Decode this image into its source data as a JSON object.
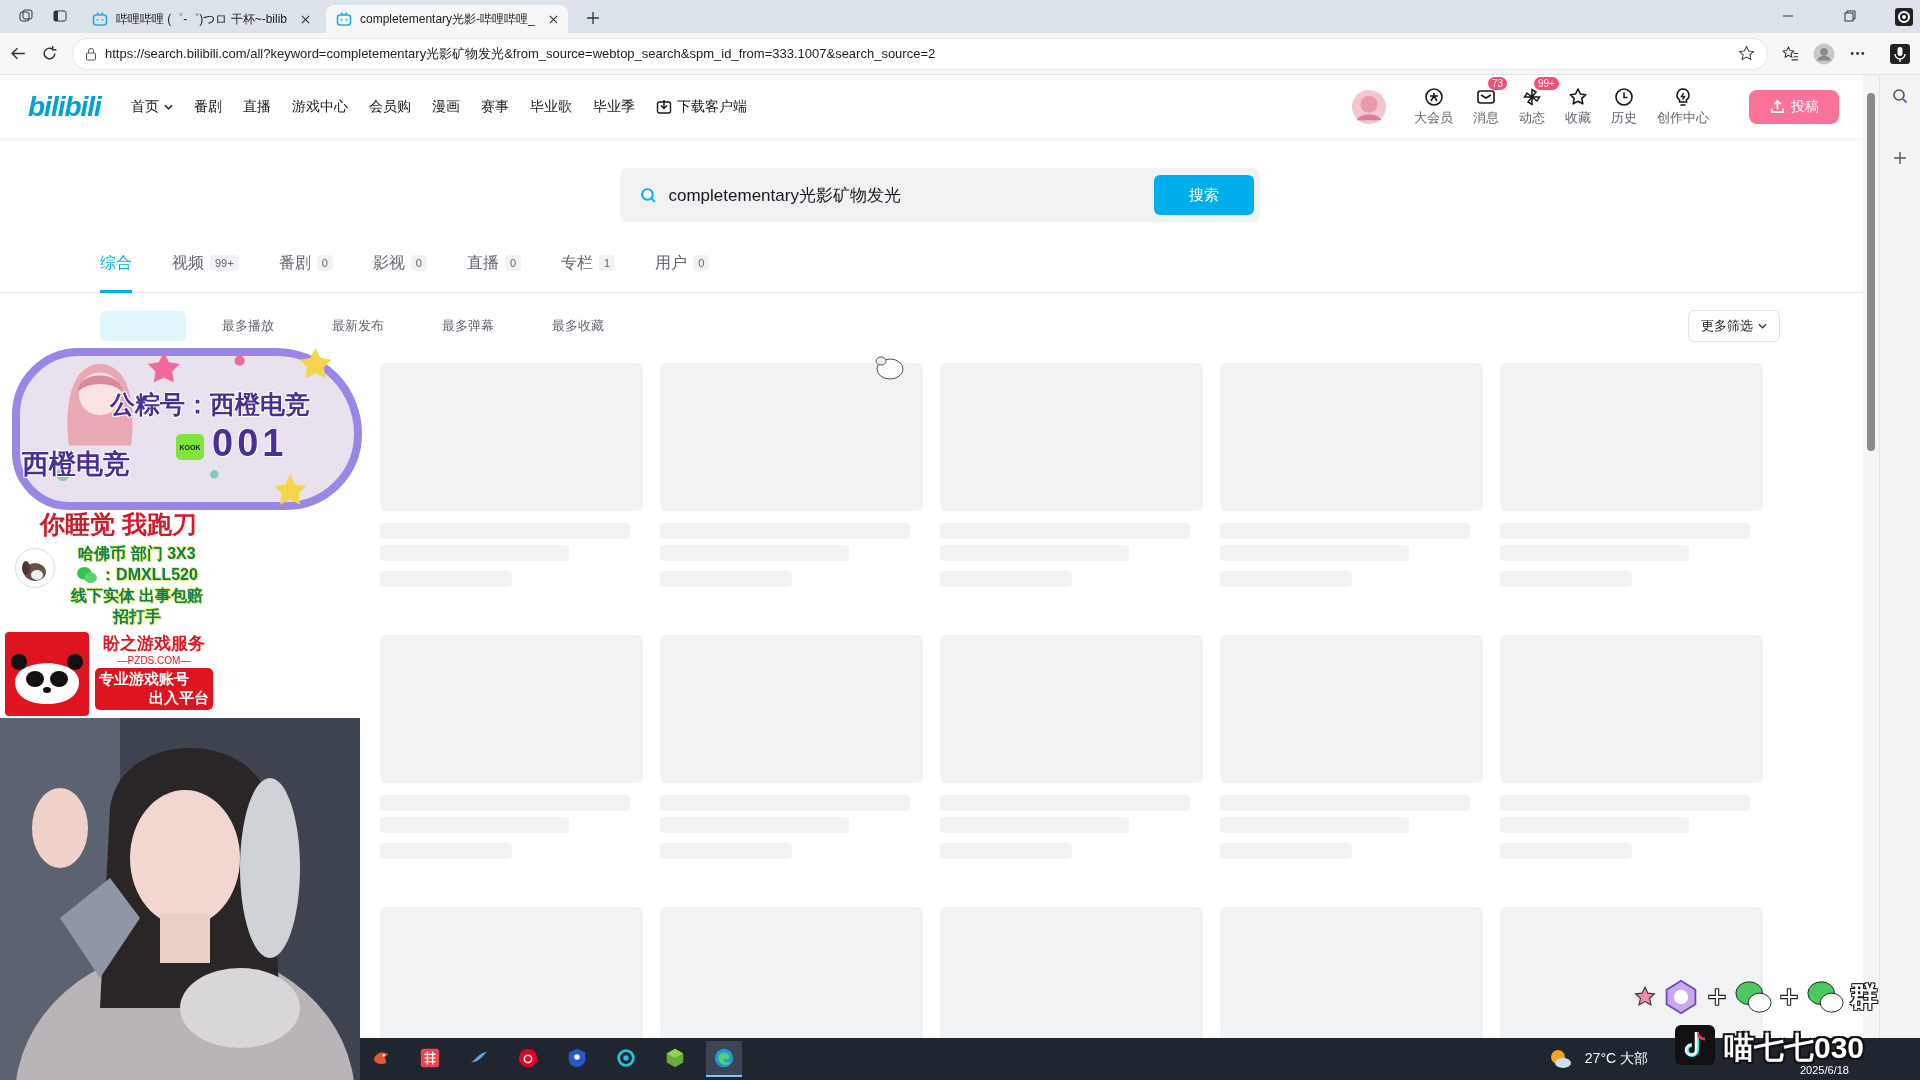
{
  "browser": {
    "tabs": [
      {
        "title": "哔哩哔哩 (゜-゜)つロ 干杯~-bilib",
        "selected": false
      },
      {
        "title": "completementary光影-哔哩哔哩_",
        "selected": true
      }
    ],
    "url": "https://search.bilibili.com/all?keyword=completementary光影矿物发光&from_source=webtop_search&spm_id_from=333.1007&search_source=2"
  },
  "header": {
    "logo": "bilibili",
    "nav": [
      {
        "label": "首页",
        "kind": "dropdown"
      },
      {
        "label": "番剧",
        "kind": "link"
      },
      {
        "label": "直播",
        "kind": "link"
      },
      {
        "label": "游戏中心",
        "kind": "link"
      },
      {
        "label": "会员购",
        "kind": "link"
      },
      {
        "label": "漫画",
        "kind": "link"
      },
      {
        "label": "赛事",
        "kind": "link"
      },
      {
        "label": "毕业歌",
        "kind": "link"
      },
      {
        "label": "毕业季",
        "kind": "link"
      },
      {
        "label": "下载客户端",
        "kind": "download"
      }
    ],
    "actions": [
      {
        "label": "大会员",
        "kind": "vip"
      },
      {
        "label": "消息",
        "kind": "mail",
        "badge": "73"
      },
      {
        "label": "动态",
        "kind": "fan",
        "badge": "99+"
      },
      {
        "label": "收藏",
        "kind": "star"
      },
      {
        "label": "历史",
        "kind": "clock"
      },
      {
        "label": "创作中心",
        "kind": "bulb"
      }
    ],
    "upload": "投稿"
  },
  "search": {
    "value": "completementary光影矿物发光",
    "button": "搜索"
  },
  "tabs": [
    {
      "label": "综合",
      "selected": true
    },
    {
      "label": "视频",
      "count": "99+",
      "selected": false
    },
    {
      "label": "番剧",
      "count": "0",
      "selected": false
    },
    {
      "label": "影视",
      "count": "0",
      "selected": false
    },
    {
      "label": "直播",
      "count": "0",
      "selected": false
    },
    {
      "label": "专栏",
      "count": "1",
      "selected": false
    },
    {
      "label": "用户",
      "count": "0",
      "selected": false
    }
  ],
  "filters": [
    {
      "selected": true
    },
    {
      "label": "最多播放",
      "selected": false
    },
    {
      "label": "最新发布",
      "selected": false
    },
    {
      "label": "最多弹幕",
      "selected": false
    },
    {
      "label": "最多收藏",
      "selected": false
    }
  ],
  "more_filters": "更多筛选",
  "results": [
    {
      "kind": "skeleton"
    },
    {
      "kind": "skeleton"
    },
    {
      "kind": "skeleton"
    },
    {
      "kind": "skeleton"
    },
    {
      "kind": "skeleton"
    },
    {
      "kind": "skeleton"
    },
    {
      "kind": "skeleton"
    },
    {
      "kind": "skeleton"
    },
    {
      "kind": "skeleton"
    },
    {
      "kind": "skeleton"
    },
    {
      "kind": "thumbnail"
    },
    {
      "kind": "thumbnail"
    },
    {
      "kind": "thumbnail"
    },
    {
      "kind": "thumbnail"
    },
    {
      "kind": "thumbnail"
    }
  ],
  "stream_overlay": {
    "banner_title": "公粽号：西橙电竞",
    "kook_logo": "KOOK",
    "kook_id": "001",
    "brand": "西橙电竞",
    "slogan": "你睡觉 我跑刀",
    "promo_lines": [
      "哈佛币 部门 3X3",
      "：DMXLL520",
      "线下实体 出事包赔",
      "招打手"
    ],
    "ad": {
      "title": "盼之游戏服务",
      "site": "—PZDS.COM—",
      "lines": [
        "专业游戏账号",
        "出入平台"
      ]
    },
    "group_mark": "群",
    "streamer": "喵七七030",
    "camera": {
      "kind": "picture"
    }
  },
  "taskbar": {
    "apps": [
      {
        "kind": "bird"
      },
      {
        "kind": "grid"
      },
      {
        "kind": "wave"
      },
      {
        "kind": "music"
      },
      {
        "kind": "letter"
      },
      {
        "kind": "ring"
      },
      {
        "kind": "cube"
      },
      {
        "kind": "edge",
        "selected": true
      }
    ],
    "weather": "27°C 大部",
    "date": "2025/6/18"
  }
}
